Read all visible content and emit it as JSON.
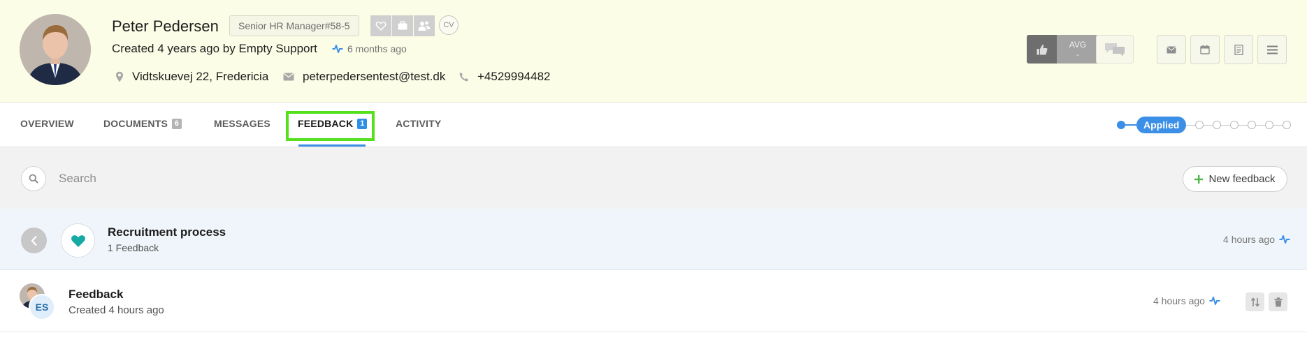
{
  "candidate": {
    "name": "Peter Pedersen",
    "job": "Senior HR Manager#58-5",
    "cv_label": "CV",
    "created": "Created 4 years ago by Empty Support",
    "last_activity": "6 months ago",
    "address": "Vidtskuevej 22, Fredericia",
    "email": "peterpedersentest@test.dk",
    "phone": "+4529994482"
  },
  "rating": {
    "avg_label": "AVG",
    "avg_value": "-"
  },
  "tabs": [
    {
      "label": "OVERVIEW"
    },
    {
      "label": "DOCUMENTS",
      "count": "6"
    },
    {
      "label": "MESSAGES"
    },
    {
      "label": "FEEDBACK",
      "count": "1"
    },
    {
      "label": "ACTIVITY"
    }
  ],
  "pipeline": {
    "current_stage": "Applied"
  },
  "search": {
    "placeholder": "Search"
  },
  "new_feedback_label": "New feedback",
  "process": {
    "title": "Recruitment process",
    "subtitle": "1 Feedback",
    "time": "4 hours ago"
  },
  "feedback_item": {
    "initials": "ES",
    "title": "Feedback",
    "subtitle": "Created 4 hours ago",
    "time": "4 hours ago"
  },
  "colors": {
    "header_bg": "#fcfde6",
    "accent_blue": "#3b8fe6",
    "highlight_green": "#55e01c",
    "heart_teal": "#17a9a4",
    "plus_green": "#4cb944"
  }
}
